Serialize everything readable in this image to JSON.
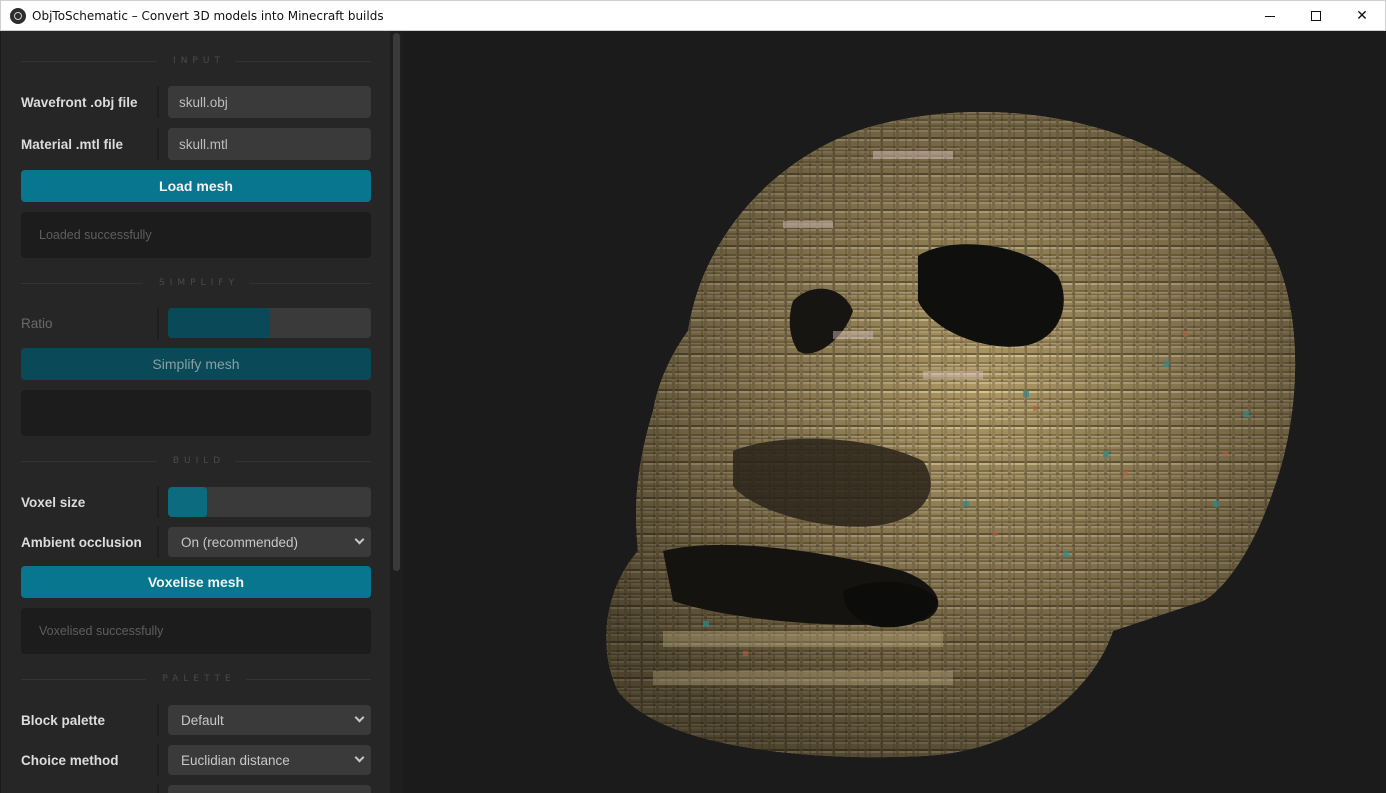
{
  "window": {
    "title": "ObjToSchematic – Convert 3D models into Minecraft builds"
  },
  "sections": {
    "input": "INPUT",
    "simplify": "SIMPLIFY",
    "build": "BUILD",
    "palette": "PALETTE"
  },
  "input": {
    "obj_label": "Wavefront .obj file",
    "obj_value": "skull.obj",
    "mtl_label": "Material .mtl file",
    "mtl_value": "skull.mtl",
    "load_button": "Load mesh",
    "status": "Loaded successfully"
  },
  "simplify": {
    "ratio_label": "Ratio",
    "ratio_value": 0.5,
    "button": "Simplify mesh",
    "status": ""
  },
  "build": {
    "voxel_size_label": "Voxel size",
    "voxel_size_value": 0.19,
    "ao_label": "Ambient occlusion",
    "ao_value": "On (recommended)",
    "button": "Voxelise mesh",
    "status": "Voxelised successfully"
  },
  "palette": {
    "block_palette_label": "Block palette",
    "block_palette_value": "Default",
    "choice_label": "Choice method",
    "choice_value": "Euclidian distance"
  },
  "colors": {
    "accent": "#08768e",
    "panel": "#262626",
    "viewport": "#1b1b1b"
  },
  "icons": [
    "app-logo-icon",
    "minimize-icon",
    "maximize-icon",
    "close-icon",
    "chevron-down-icon"
  ]
}
